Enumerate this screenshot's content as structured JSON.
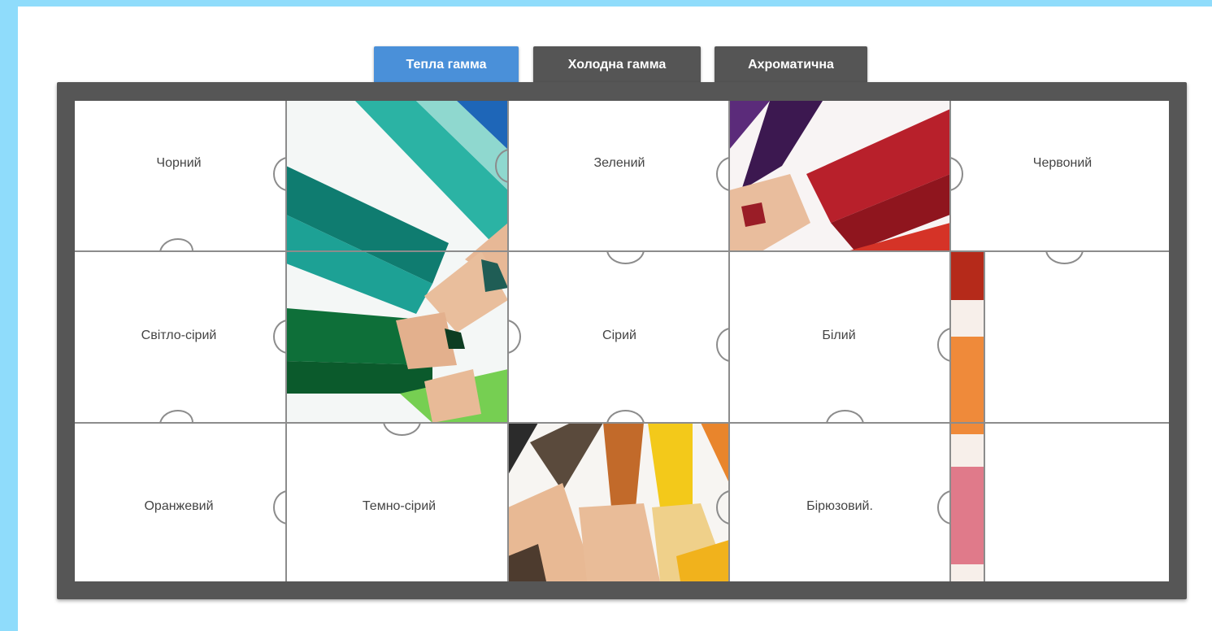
{
  "tabs": [
    {
      "label": "Тепла гамма",
      "active": true
    },
    {
      "label": "Холодна гамма",
      "active": false
    },
    {
      "label": "Ахроматична",
      "active": false
    }
  ],
  "pieces": [
    {
      "label": "Чорний"
    },
    {
      "label": "Зелений"
    },
    {
      "label": "Червоний"
    },
    {
      "label": "Світло-сірий"
    },
    {
      "label": "Сірий"
    },
    {
      "label": "Білий"
    },
    {
      "label": "Оранжевий"
    },
    {
      "label": "Темно-сірий"
    },
    {
      "label": "Бірюзовий."
    }
  ],
  "colors": {
    "frame": "#565656",
    "active_tab": "#4a90d9",
    "inactive_tab": "#555555",
    "page_edge": "#8fdcfb"
  }
}
